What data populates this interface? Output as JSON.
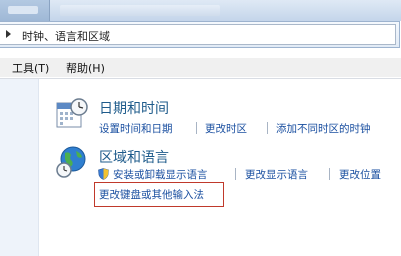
{
  "addressbar": {
    "path": "时钟、语言和区域"
  },
  "menu": {
    "tools": "工具(T)",
    "help": "帮助(H)"
  },
  "sections": [
    {
      "title": "日期和时间",
      "icon": "calendar-clock-icon",
      "links": [
        "设置时间和日期",
        "更改时区",
        "添加不同时区的时钟"
      ]
    },
    {
      "title": "区域和语言",
      "icon": "globe-clock-icon",
      "links": [
        "安装或卸载显示语言",
        "更改显示语言",
        "更改位置"
      ],
      "extra_link": "更改键盘或其他输入法"
    }
  ],
  "colors": {
    "link": "#1a4fa0",
    "title": "#1e5b8b",
    "highlight": "#c0392b"
  }
}
